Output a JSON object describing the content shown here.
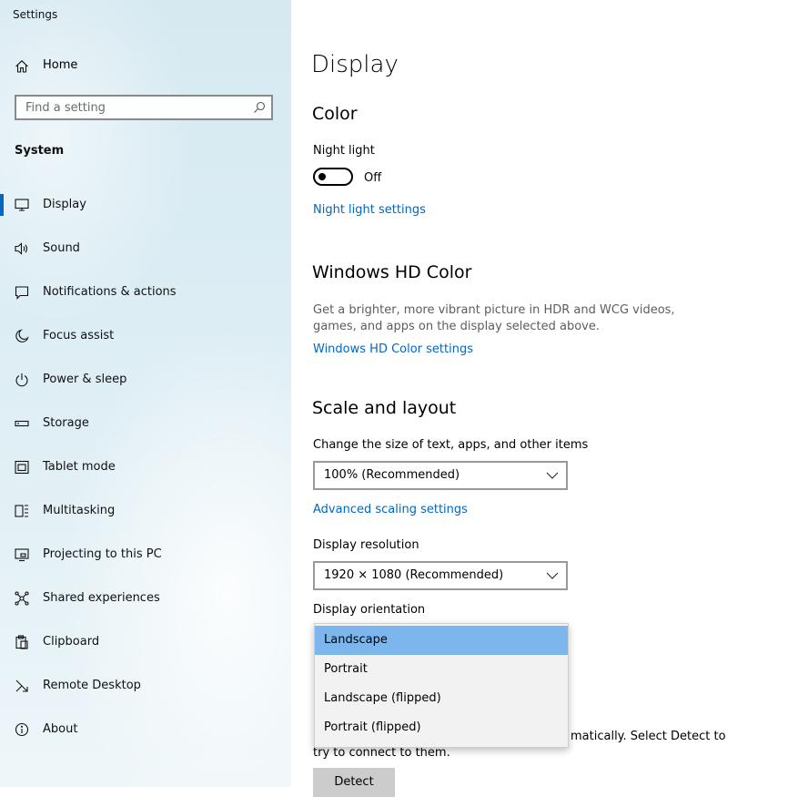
{
  "window": {
    "title": "Settings"
  },
  "sidebar": {
    "home_label": "Home",
    "search_placeholder": "Find a setting",
    "section_label": "System",
    "items": [
      {
        "label": "Display",
        "icon": "monitor-icon",
        "active": true
      },
      {
        "label": "Sound",
        "icon": "speaker-icon"
      },
      {
        "label": "Notifications & actions",
        "icon": "notification-icon"
      },
      {
        "label": "Focus assist",
        "icon": "moon-icon"
      },
      {
        "label": "Power & sleep",
        "icon": "power-icon"
      },
      {
        "label": "Storage",
        "icon": "storage-icon"
      },
      {
        "label": "Tablet mode",
        "icon": "tablet-icon"
      },
      {
        "label": "Multitasking",
        "icon": "multitasking-icon"
      },
      {
        "label": "Projecting to this PC",
        "icon": "projecting-icon"
      },
      {
        "label": "Shared experiences",
        "icon": "shared-icon"
      },
      {
        "label": "Clipboard",
        "icon": "clipboard-icon"
      },
      {
        "label": "Remote Desktop",
        "icon": "remote-desktop-icon"
      },
      {
        "label": "About",
        "icon": "info-icon"
      }
    ]
  },
  "main": {
    "title": "Display",
    "color": {
      "heading": "Color",
      "night_light_label": "Night light",
      "night_light_state": "Off",
      "night_light_link": "Night light settings"
    },
    "hd_color": {
      "heading": "Windows HD Color",
      "description": "Get a brighter, more vibrant picture in HDR and WCG videos, games, and apps on the display selected above.",
      "link": "Windows HD Color settings"
    },
    "scale_layout": {
      "heading": "Scale and layout",
      "scale_label": "Change the size of text, apps, and other items",
      "scale_value": "100% (Recommended)",
      "advanced_link": "Advanced scaling settings",
      "resolution_label": "Display resolution",
      "resolution_value": "1920 × 1080 (Recommended)",
      "orientation_label": "Display orientation",
      "orientation_options": [
        "Landscape",
        "Portrait",
        "Landscape (flipped)",
        "Portrait (flipped)"
      ],
      "orientation_selected": "Landscape"
    },
    "multiple_displays": {
      "partial_text_line1": "matically. Select Detect to",
      "partial_text_line2": "try to connect to them.",
      "detect_button": "Detect"
    }
  },
  "colors": {
    "accent": "#0067c0",
    "dropdown_selected": "#7cb6ec",
    "sidebar_bg": "#dcedf4"
  }
}
